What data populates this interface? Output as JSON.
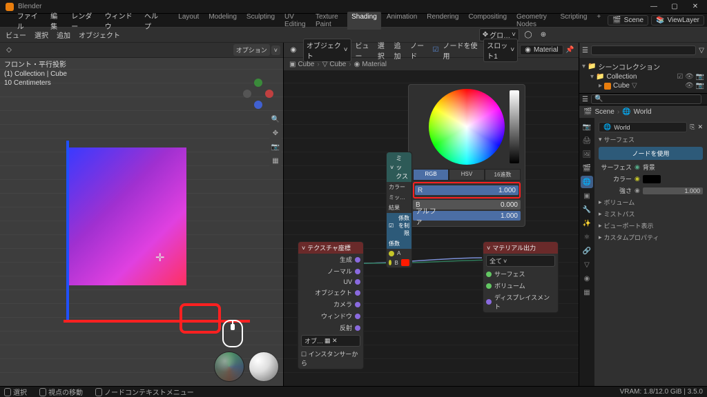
{
  "app": {
    "title": "Blender"
  },
  "win_controls": {
    "min": "—",
    "max": "▢",
    "close": "✕"
  },
  "menu": {
    "blender_icon": "blender",
    "items": [
      "ファイル",
      "編集",
      "レンダー",
      "ウィンドウ",
      "ヘルプ"
    ],
    "tabs": [
      "Layout",
      "Modeling",
      "Sculpting",
      "UV Editing",
      "Texture Paint",
      "Shading",
      "Animation",
      "Rendering",
      "Compositing",
      "Geometry Nodes",
      "Scripting"
    ],
    "active_tab": 5,
    "scene": {
      "label": "Scene",
      "value": "Scene"
    },
    "viewlayer": {
      "label": "ViewLayer",
      "value": "ViewLayer"
    }
  },
  "toolbar": {
    "mode_items": [
      "ビュー",
      "選択",
      "追加",
      "オブジェクト"
    ],
    "global": "グロ…"
  },
  "vp": {
    "options_btn": "オプション",
    "info": [
      "フロント・平行投影",
      "(1) Collection | Cube",
      "10 Centimeters"
    ]
  },
  "nodehdr": {
    "items": [
      "オブジェクト",
      "ビュー",
      "選択",
      "追加",
      "ノード"
    ],
    "use_nodes": "ノードを使用",
    "slot": "スロット1",
    "material": "Material"
  },
  "breadcrumb": [
    "Cube",
    "Cube",
    "Material"
  ],
  "colorpicker": {
    "tabs": [
      "RGB",
      "HSV",
      "16進数"
    ],
    "prefix": {
      "color": "カラー",
      "mix": "ミッ…",
      "result": "結果",
      "clamp": "係数を制限",
      "factor": "係数"
    },
    "r": {
      "label": "R",
      "value": "1.000"
    },
    "g_hidden": "",
    "b": {
      "label": "B",
      "value": "0.000"
    },
    "alpha": {
      "label": "アルファ",
      "value": "1.000"
    }
  },
  "mix_node": {
    "title": "ミックス",
    "a": "A",
    "b": "B"
  },
  "tex_node": {
    "title": "テクスチャ座標",
    "outputs": [
      "生成",
      "ノーマル",
      "UV",
      "オブジェクト",
      "カメラ",
      "ウィンドウ",
      "反射"
    ],
    "object_field": "オブ…",
    "instancer": "インスタンサーから"
  },
  "out_node": {
    "title": "マテリアル出力",
    "all": "全て",
    "inputs": [
      "サーフェス",
      "ボリューム",
      "ディスプレイスメント"
    ]
  },
  "outliner": {
    "scene_collection": "シーンコレクション",
    "collection": "Collection",
    "cube": "Cube"
  },
  "props": {
    "search_placeholder": "",
    "scene": "Scene",
    "world": "World",
    "world2": "World",
    "surface_panel": "サーフェス",
    "use_nodes_btn": "ノードを使用",
    "surface_label": "サーフェス",
    "surface_value": "背景",
    "color_label": "カラー",
    "strength_label": "強さ",
    "strength_value": "1.000",
    "panels": [
      "ボリューム",
      "ミストパス",
      "ビューポート表示",
      "カスタムプロパティ"
    ]
  },
  "status": {
    "select": "選択",
    "move_view": "視点の移動",
    "context": "ノードコンテキストメニュー",
    "vram": "VRAM: 1.8/12.0 GiB | 3.5.0"
  }
}
